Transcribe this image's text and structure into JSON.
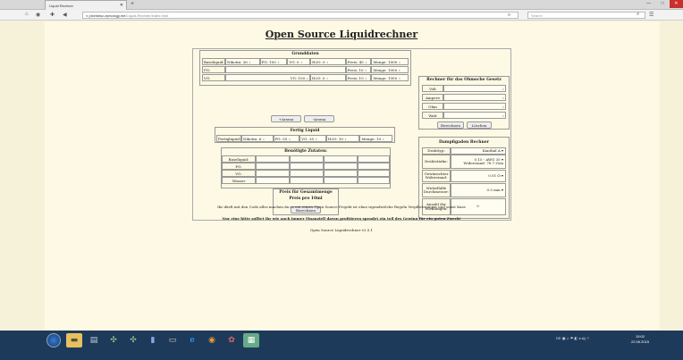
{
  "browser": {
    "tab_title": "Liquid Rechner",
    "new_tab": "+",
    "url_host": "pixelsbsc.zymology.me",
    "url_path": "/Liquid-Rechner/index.html",
    "search_placeholder": "Search",
    "window_buttons": [
      "—",
      "□",
      "✕"
    ]
  },
  "page": {
    "title": "Open Source Liquidrechner",
    "grunddaten": {
      "title": "Grunddaten",
      "rows": [
        {
          "label": "Baseliquid:",
          "fields": [
            {
              "label": "Nikotin:",
              "value": "36"
            },
            {
              "label": "PG:",
              "value": "100"
            },
            {
              "label": "VG:",
              "value": "0"
            },
            {
              "label": "H2O:",
              "value": "0"
            }
          ],
          "price_label": "Preis:",
          "price": "45",
          "menge_label": "Menge:",
          "menge": "1000"
        },
        {
          "label": "PG:",
          "fields": [],
          "price_label": "Preis:",
          "price": "10",
          "menge_label": "Menge:",
          "menge": "1000"
        },
        {
          "label": "VG:",
          "fields": [
            {
              "label": "VG:",
              "value": "100"
            },
            {
              "label": "H2O:",
              "value": "0"
            }
          ],
          "price_label": "Preis:",
          "price": "10",
          "menge_label": "Menge:",
          "menge": "1000"
        }
      ],
      "add_aroma": "+Aroma",
      "remove_aroma": "-Aroma"
    },
    "fertig": {
      "title": "Fertig Liquid",
      "label": "Fertigliquid:",
      "fields": [
        {
          "label": "Nikotin:",
          "value": "6"
        },
        {
          "label": "PG:",
          "value": "55"
        },
        {
          "label": "VG:",
          "value": "35"
        },
        {
          "label": "H2O:",
          "value": "10"
        },
        {
          "label": "Menge:",
          "value": "10"
        }
      ]
    },
    "zutaten": {
      "title": "Benötigte Zutaten:",
      "rows": [
        "Baseliquid:",
        "PG:",
        "VG:",
        "Wasser"
      ]
    },
    "preis": {
      "title": "Preis für Gesamtmenge",
      "per10": "Preis pro 10ml",
      "button": "Berechnen"
    },
    "ohm": {
      "title": "Rechner für das Ohmsche Gesetz",
      "rows": [
        "Volt",
        "Ampere",
        "Ohm",
        "Watt"
      ],
      "calc": "Berechnen",
      "clear": "Löschen"
    },
    "damp": {
      "title": "Dampfigaden Rechner",
      "rows": [
        {
          "label": "Drahttyp:",
          "value": "Kanthal A ▾"
        },
        {
          "label": "Drahtstärke:",
          "value": "0.15 - AWG 35 ▾ Widerstand: 78.7 Ω/m"
        },
        {
          "label": "Gewünschter Widerstand:",
          "value": "0.01 Ω ▾"
        },
        {
          "label": "Wickelhilfe Durchmesser:",
          "value": "0.5 mm ▾"
        },
        {
          "label": "Anzahl der Wicklungen:",
          "value": "0"
        }
      ]
    },
    "footer": [
      "Ihr dürft mit den Code alles machen da es ein reines Open Source Projekt ist ohne irgendwelche Regeln Verpflichtungen und sonst Kase",
      "Nur eine bitte solltet ihr wie auch immer Finanziell davon profitieren spendet ein teil des Gewinn für ein guten Zweck!",
      "Open Source Liquidrechner v2.0.1"
    ]
  },
  "taskbar": {
    "tray_text": "DE",
    "time": "15:02",
    "date": "22.06.2015"
  }
}
